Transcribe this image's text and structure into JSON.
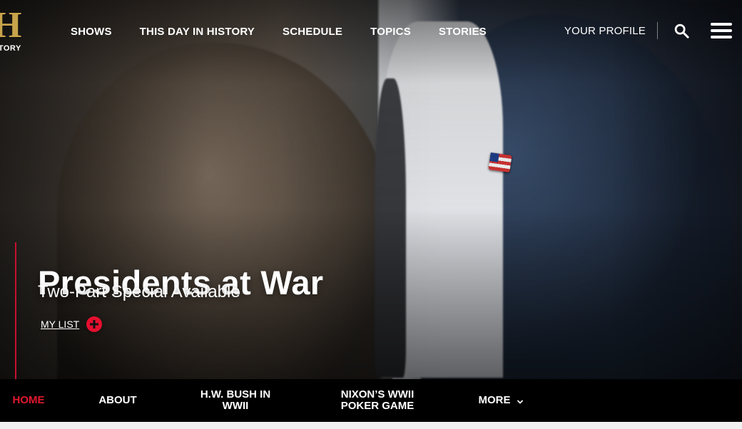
{
  "brand": {
    "logo_letter": "H",
    "logo_text": "STORY"
  },
  "top_nav": {
    "items": [
      "SHOWS",
      "THIS DAY IN HISTORY",
      "SCHEDULE",
      "TOPICS",
      "STORIES"
    ],
    "profile_label": "YOUR PROFILE"
  },
  "hero": {
    "title": "Presidents at War",
    "subtitle": "Two-Part Special Available",
    "mylist_label": "MY LIST"
  },
  "sub_nav": {
    "tabs": [
      {
        "label": "HOME",
        "active": true
      },
      {
        "label": "ABOUT",
        "active": false
      },
      {
        "label": "H.W. BUSH IN WWII",
        "active": false
      },
      {
        "label": "NIXON’S WWII POKER GAME",
        "active": false
      },
      {
        "label": "MORE",
        "active": false
      }
    ]
  },
  "colors": {
    "accent_red": "#e1192d",
    "logo_gold": "#c8a34a"
  },
  "icons": {
    "search": "search-icon",
    "menu": "hamburger-menu-icon",
    "mylist_add": "plus-circle-icon",
    "more_chevron": "chevron-down-icon"
  }
}
